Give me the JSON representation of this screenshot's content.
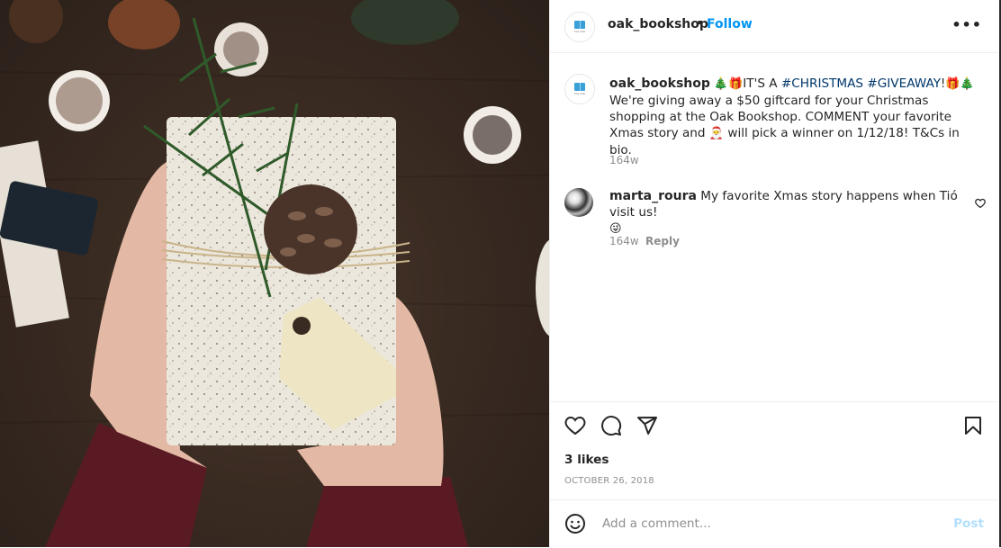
{
  "post": {
    "image_alt": "Hands holding a white speckled gift wrapped with twine, pine cone, evergreen sprig and blank tag on a wooden table with pine cones",
    "image_colors": {
      "wood": "#3a2b22",
      "gift": "#ece7dc",
      "sweater": "#5a1a24",
      "evergreen": "#2f5a2a"
    }
  },
  "header": {
    "username": "oak_bookshop",
    "separator": "•",
    "follow_label": "Follow",
    "more_label": "•••",
    "avatar_label": "The Oak"
  },
  "caption": {
    "username": "oak_bookshop",
    "emoji_open": "🎄🎁",
    "text_intro": "IT'S A ",
    "hashtag1": "#CHRISTMAS",
    "hashtag2": "#GIVEAWAY",
    "emoji_close": "!🎁🎄",
    "text_body": " We're giving away a $50 giftcard for your Christmas shopping at the Oak Bookshop. COMMENT your favorite Xmas story and ",
    "emoji_santa": "🎅",
    "text_end": " will pick a winner on 1/12/18! T&Cs in bio.",
    "time": "164w"
  },
  "comment": {
    "username": "marta_roura",
    "text": "My favorite Xmas story happens when Tió visit us!",
    "emoji": "😜",
    "time": "164w",
    "reply_label": "Reply"
  },
  "actions": {
    "likes": "3 likes",
    "date": "OCTOBER 26, 2018"
  },
  "add_comment": {
    "placeholder": "Add a comment...",
    "value": "",
    "post_label": "Post"
  },
  "colors": {
    "link": "#0095f6",
    "hashtag": "#00376b",
    "muted": "#8e8e8e",
    "post_disabled": "#b2dffc"
  }
}
